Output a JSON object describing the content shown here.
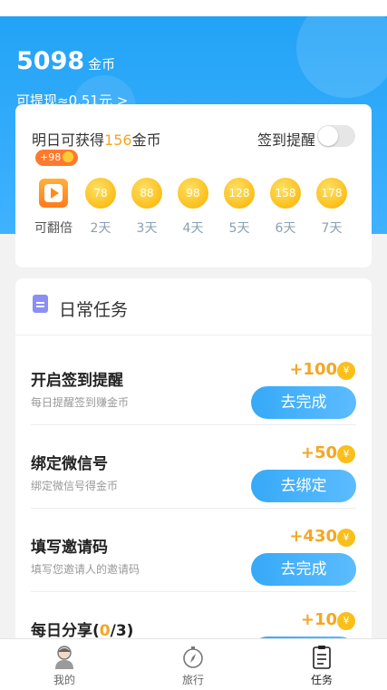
{
  "wallet": {
    "coins": "5098",
    "unit": "金币",
    "withdraw": "可提现≈0.51元 >"
  },
  "checkin": {
    "title_prefix": "明日可获得",
    "title_amount": "156",
    "title_suffix": "金币",
    "reminder_label": "签到提醒",
    "reminder_on": false,
    "bonus_badge": "+98",
    "coins": [
      "78",
      "88",
      "98",
      "128",
      "158",
      "178"
    ],
    "days": [
      "可翻倍",
      "2天",
      "3天",
      "4天",
      "5天",
      "6天",
      "7天"
    ]
  },
  "tasks_section": {
    "title": "日常任务",
    "items": [
      {
        "name": "开启签到提醒",
        "desc": "每日提醒签到赚金币",
        "reward": "+100",
        "button": "去完成"
      },
      {
        "name": "绑定微信号",
        "desc": "绑定微信号得金币",
        "reward": "+50",
        "button": "去绑定"
      },
      {
        "name": "填写邀请码",
        "desc": "填写您邀请人的邀请码",
        "reward": "+430",
        "button": "去完成"
      },
      {
        "name": "每日分享",
        "count": "0",
        "total": "/3)",
        "reward": "+10",
        "button": ""
      }
    ]
  },
  "coin_symbol": "¥",
  "tabbar": {
    "items": [
      {
        "label": "我的"
      },
      {
        "label": "旅行"
      },
      {
        "label": "任务"
      }
    ],
    "active": "任务"
  },
  "colors": {
    "primary": "#3aaaf8",
    "accent": "#f5a623"
  }
}
